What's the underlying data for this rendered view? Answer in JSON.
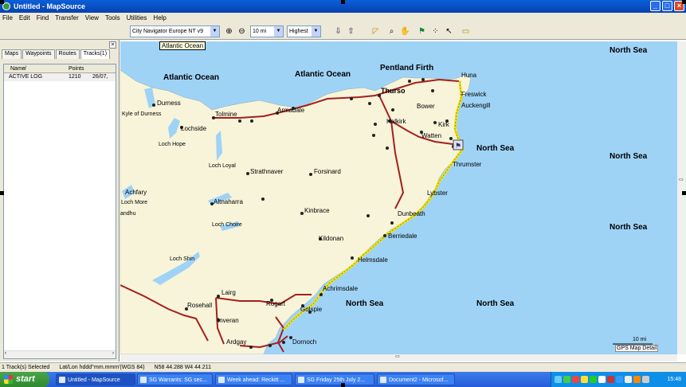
{
  "window": {
    "title": "Untitled - MapSource",
    "min": "_",
    "max": "□",
    "close": "×"
  },
  "menu": [
    "File",
    "Edit",
    "Find",
    "Transfer",
    "View",
    "Tools",
    "Utilities",
    "Help"
  ],
  "toolbar": {
    "product": "City Navigator Europe NT v9",
    "scale": "10 mi",
    "detail": "Highest",
    "tooltip": "Atlantic Ocean"
  },
  "panel": {
    "tabs": [
      "Maps",
      "Waypoints",
      "Routes",
      "Tracks(1)"
    ],
    "active_tab": "Tracks(1)",
    "columns": {
      "name": "Name",
      "sort": "/",
      "points": "Points"
    },
    "rows": [
      {
        "name": "ACTIVE LOG",
        "points": "1210",
        "date": "26/07,"
      }
    ]
  },
  "map": {
    "scale_bar": "10 mi",
    "map_detail": "GPS Map Detail",
    "labels": {
      "north_sea_1": "North Sea",
      "north_sea_2": "North Sea",
      "north_sea_3": "North Sea",
      "north_sea_4": "North Sea",
      "north_sea_5": "North Sea",
      "north_sea_6": "North Sea",
      "atlantic_1": "Atlantic Ocean",
      "atlantic_2": "Atlantic Ocean",
      "pentland": "Pentland Firth",
      "thurso": "Thurso",
      "huna": "Huna",
      "freswick": "Freswick",
      "auckengill": "Auckengill",
      "bower": "Bower",
      "kirk": "Kirk",
      "halkirk": "Halkirk",
      "watten": "Watten",
      "thrumster": "Thrumster",
      "lybster": "Lybster",
      "dunbeath": "Dunbeath",
      "berriedale": "Berriedale",
      "helmsdale": "Helmsdale",
      "achrimsdale": "Achrimsdale",
      "golspie": "Golspie",
      "dornoch": "Dornoch",
      "ardgay": "Ardgay",
      "invershin": "Inveran",
      "rosehall": "Rosehall",
      "lairg": "Lairg",
      "rogart": "Rogart",
      "kildonan": "Kildonan",
      "kinbrace": "Kinbrace",
      "forsinard": "Forsinard",
      "strathnaver": "Strathnaver",
      "altnaharra": "Altnaharra",
      "lochchoire": "Loch Choire",
      "lochloyal": "Loch Loyal",
      "lochshin": "Loch Shin",
      "achfary": "Achfary",
      "lochmore": "Loch More",
      "andhu": "andhu",
      "lochside": "Lochside",
      "lochhope": "Loch Hope",
      "durness": "Durness",
      "kyleofdurness": "Kyle of Durness",
      "tolmine": "Tolmine",
      "armadale": "Armadale"
    }
  },
  "status": {
    "selected": "1 Track(s) Selected",
    "format": "Lat/Lon hddd°mm.mmm'(WGS 84)",
    "coords": "N58 44.288 W4 44.211"
  },
  "taskbar": {
    "start": "start",
    "tasks": [
      "Untitled - MapSource",
      "SG Warrants: SG sec...",
      "Week ahead: Reckitt ...",
      "SG Friday 25th July 2...",
      "Document2 - Microsof..."
    ],
    "clock": "15:48"
  }
}
